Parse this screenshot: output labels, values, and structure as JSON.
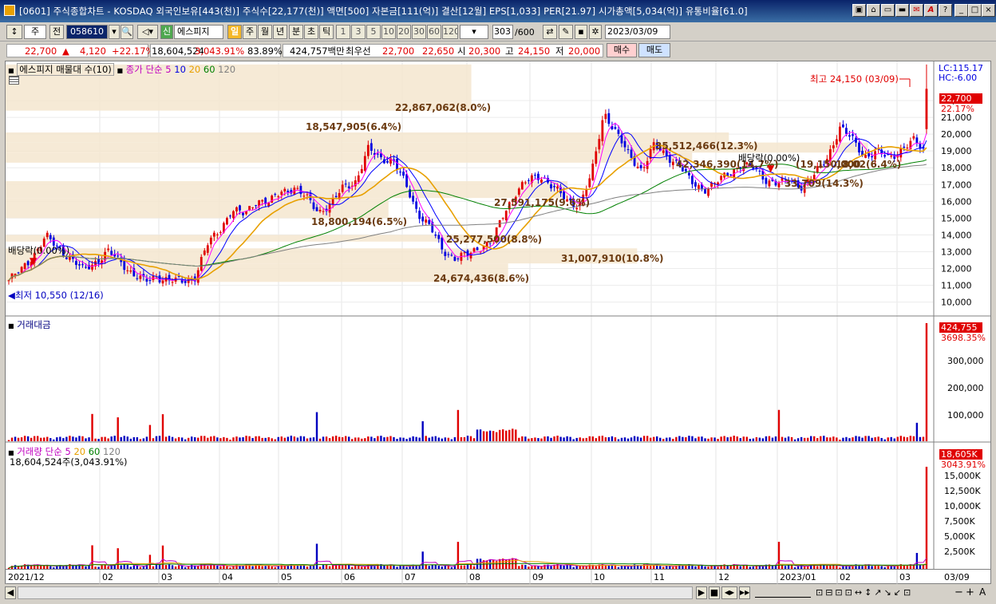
{
  "window": {
    "title": "[0601] 주식종합차트 - KOSDAQ 외국인보유[443(천)] 주식수[22,177(천)] 액면[500] 자본금[111(억)] 결산[12월] EPS[1,033] PER[21.97] 시가총액[5,034(억)] 유통비율[61.0]",
    "buttons": [
      "□",
      "▭",
      "▬",
      "✉",
      "A",
      "?",
      "_",
      "□",
      "×"
    ]
  },
  "toolbar": {
    "period_type": "주",
    "prev_label": "전",
    "stock_code": "058610",
    "stock_name": "에스피지",
    "tag_label": "신",
    "periods": [
      "일",
      "주",
      "월",
      "년",
      "분",
      "초",
      "틱"
    ],
    "active_period": "일",
    "minute_options": [
      "1",
      "3",
      "5",
      "10",
      "20",
      "30",
      "60",
      "120"
    ],
    "count": "303",
    "max_count": "/600",
    "date": "2023/03/09"
  },
  "quote": {
    "price": "22,700",
    "arrow": "▲",
    "change": "4,120",
    "change_pct": "+22.17%",
    "volume": "18,604,524",
    "volume_pct": "3,043.91%",
    "turnover_pct": "83.89%",
    "amount": "424,757백만",
    "best_label": "최우선",
    "ask": "22,700",
    "bid": "22,650",
    "open_label": "시",
    "open": "20,300",
    "high_label": "고",
    "high": "24,150",
    "low_label": "저",
    "low": "20,000",
    "buy_label": "매수",
    "sell_label": "매도"
  },
  "price_pane": {
    "legend_title": "에스피지 매물대 수(10)",
    "legend_ma": "종가 단순",
    "ma_periods": [
      "5",
      "10",
      "20",
      "60",
      "120"
    ],
    "ma_colors": [
      "#ff00ff",
      "#0000ff",
      "#e8a000",
      "#008000",
      "#808080"
    ],
    "lc": "LC:115.17",
    "hc": "HC:-6.00",
    "current_price": "22,700",
    "current_pct": "22.17%",
    "high_note": "최고 24,150 (03/09)",
    "low_note": "최저 10,550 (12/16)",
    "dividend_left": "배당락(0.00%)",
    "dividend_right": "배당락(0.00%)",
    "y_ticks": [
      "22,000",
      "21,000",
      "20,000",
      "19,000",
      "18,000",
      "17,000",
      "16,000",
      "15,000",
      "14,000",
      "13,000",
      "12,000",
      "11,000",
      "10,000"
    ],
    "volume_profile_labels": [
      "22,867,062(8.0%)",
      "18,547,905(6.4%)",
      "35,512,466(12.3%)",
      "42,346,390(14.7%)",
      "(19,150,000",
      "18,02(6.4%)",
      "33,709(14.3%)",
      "27,591,175(9.6%)",
      "18,800,194(6.5%)",
      "25,277,500(8.8%)",
      "31,007,910(10.8%)",
      "24,674,436(8.6%)"
    ]
  },
  "amount_pane": {
    "legend": "거래대금",
    "current": "424,755",
    "current_pct": "3698.35%",
    "y_ticks": [
      "300,000",
      "200,000",
      "100,000"
    ]
  },
  "volume_pane": {
    "legend": "거래량",
    "legend_ma": "단순",
    "ma_periods": [
      "5",
      "20",
      "60",
      "120"
    ],
    "sub": "18,604,524주(3,043.91%)",
    "current": "18,605K",
    "current_pct": "3043.91%",
    "y_ticks": [
      "15,000K",
      "12,500K",
      "10,000K",
      "7,500K",
      "5,000K",
      "2,500K"
    ]
  },
  "x_axis": {
    "labels": [
      "2021/12",
      "02",
      "03",
      "04",
      "05",
      "06",
      "07",
      "08",
      "09",
      "10",
      "11",
      "12",
      "2023/01",
      "02",
      "03"
    ],
    "right_label": "03/09"
  },
  "chart_data": {
    "type": "candlestick",
    "title": "에스피지",
    "period": "daily",
    "last": {
      "date": "2023/03/09",
      "open": 20300,
      "high": 24150,
      "low": 20000,
      "close": 22700,
      "volume": 18604524
    },
    "price_range": [
      10000,
      23000
    ],
    "key_points": [
      {
        "label": "최저",
        "date": "12/16",
        "price": 10550
      },
      {
        "label": "최고",
        "date": "03/09",
        "price": 24150
      }
    ],
    "close_path": [
      11300,
      11900,
      12800,
      13900,
      13200,
      12600,
      11900,
      12400,
      13000,
      12400,
      11700,
      11200,
      11500,
      11300,
      11200,
      11500,
      13400,
      14300,
      15500,
      15200,
      16100,
      15900,
      16600,
      16800,
      16200,
      15400,
      15800,
      16900,
      17200,
      19100,
      18600,
      18400,
      17000,
      15300,
      14400,
      13100,
      12600,
      12800,
      13300,
      13600,
      15400,
      16700,
      17300,
      17500,
      16800,
      16000,
      15800,
      17600,
      21300,
      20100,
      18700,
      17900,
      19300,
      18700,
      18300,
      17100,
      16700,
      17100,
      17600,
      18200,
      18000,
      17300,
      17100,
      17200,
      16900,
      17600,
      18600,
      20400,
      19700,
      18700,
      18900,
      18600,
      19100,
      19600,
      18900
    ],
    "volume_profile": [
      {
        "price_level": "22,000-24,150",
        "volume": 22867062,
        "pct": 8.0
      },
      {
        "price_level": "19,700-21,000",
        "volume": 35512466,
        "pct": 12.3
      },
      {
        "price_level": "18,500-19,700",
        "volume": 42346390,
        "pct": 14.7
      },
      {
        "price_level": "17,300-18,500",
        "volume": 33709000,
        "pct": 14.3
      },
      {
        "price_level": "16,000-17,300",
        "volume": 27591175,
        "pct": 9.6
      },
      {
        "price_level": "14,800-16,000",
        "volume": 18800194,
        "pct": 6.5
      },
      {
        "price_level": "13,600-14,800",
        "volume": 25277500,
        "pct": 8.8
      },
      {
        "price_level": "12,300-13,600",
        "volume": 31007910,
        "pct": 10.8
      },
      {
        "price_level": "11,000-12,300",
        "volume": 24674436,
        "pct": 8.6
      }
    ]
  },
  "status": {
    "nav": [
      "◀",
      "▶",
      "■",
      "◀▶",
      "▶▶"
    ],
    "zoom": [
      "−",
      "+",
      "A"
    ]
  }
}
